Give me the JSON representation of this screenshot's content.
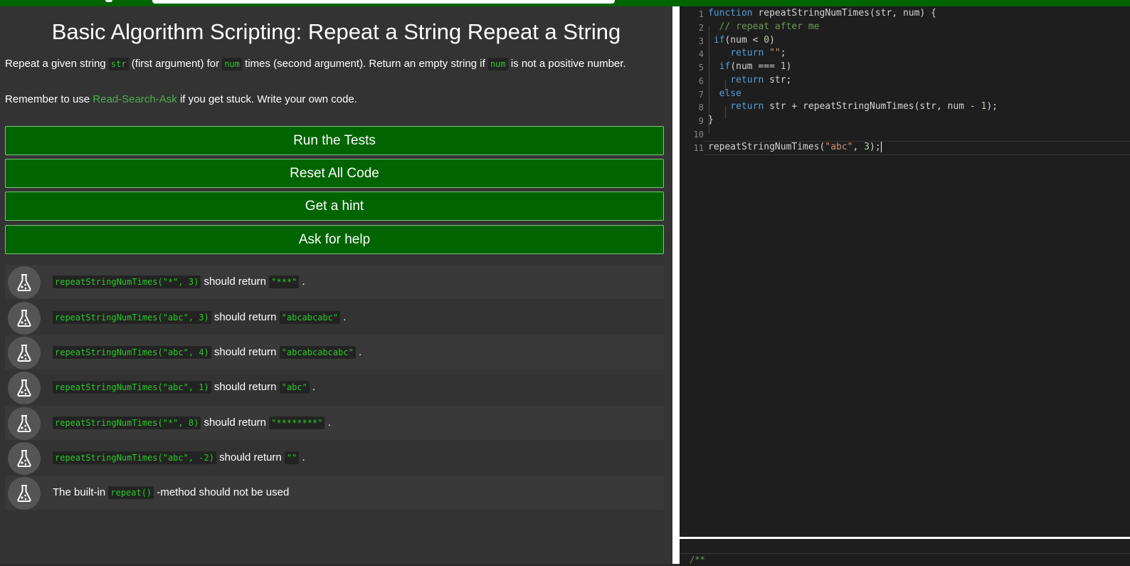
{
  "challenge": {
    "title": "Basic Algorithm Scripting: Repeat a String Repeat a String",
    "desc_1": "Repeat a given string ",
    "desc_code_1": "str",
    "desc_2": " (first argument) for ",
    "desc_code_2": "num",
    "desc_3": " times (second argument). Return an empty string if ",
    "desc_code_3": "num",
    "desc_4": " is not a positive number.",
    "remember_1": "Remember to use ",
    "remember_link": "Read-Search-Ask",
    "remember_2": " if you get stuck. Write your own code."
  },
  "buttons": {
    "run": "Run the Tests",
    "reset": "Reset All Code",
    "hint": "Get a hint",
    "help": "Ask for help"
  },
  "tests": [
    {
      "code": "repeatStringNumTimes(\"*\", 3)",
      "mid": " should return ",
      "result": "\"***\"",
      "end": " ."
    },
    {
      "code": "repeatStringNumTimes(\"abc\", 3)",
      "mid": " should return ",
      "result": "\"abcabcabc\"",
      "end": " ."
    },
    {
      "code": "repeatStringNumTimes(\"abc\", 4)",
      "mid": " should return ",
      "result": "\"abcabcabcabc\"",
      "end": " ."
    },
    {
      "code": "repeatStringNumTimes(\"abc\", 1)",
      "mid": " should return ",
      "result": "\"abc\"",
      "end": " ."
    },
    {
      "code": "repeatStringNumTimes(\"*\", 8)",
      "mid": " should return ",
      "result": "\"********\"",
      "end": " ."
    },
    {
      "code": "repeatStringNumTimes(\"abc\", -2)",
      "mid": " should return ",
      "result": "\"\"",
      "end": " ."
    },
    {
      "pre": "The built-in ",
      "code": "repeat()",
      "post": " -method should not be used"
    }
  ],
  "editor": {
    "line_numbers": [
      "1",
      "2",
      "3",
      "4",
      "5",
      "6",
      "7",
      "8",
      "9",
      "10",
      "11"
    ],
    "console_text": "/**"
  }
}
